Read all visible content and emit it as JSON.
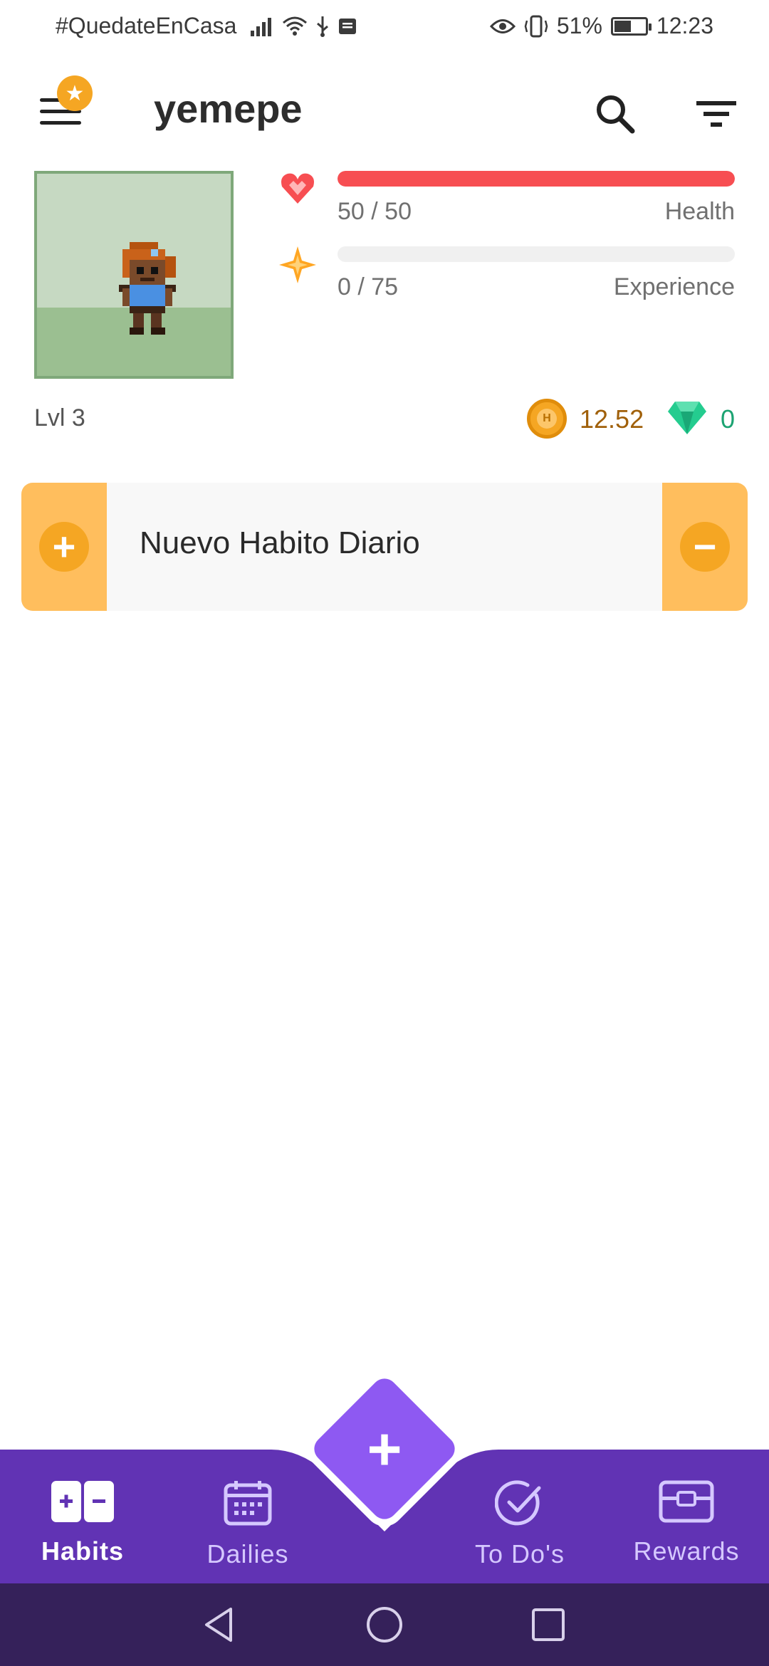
{
  "status_bar": {
    "carrier_text": "#QuedateEnCasa",
    "battery": "51%",
    "time": "12:23",
    "icons": [
      "signal-icon",
      "wifi-icon",
      "usb-icon",
      "notification-icon",
      "eye-icon",
      "vibrate-icon",
      "battery-icon"
    ]
  },
  "header": {
    "title": "yemepe",
    "icons": [
      "menu-icon",
      "star-badge-icon",
      "search-icon",
      "filter-icon"
    ]
  },
  "stats": {
    "health": {
      "value": "50 / 50",
      "label": "Health",
      "fraction": 1.0,
      "color": "#f74e52"
    },
    "experience": {
      "value": "0 / 75",
      "label": "Experience",
      "fraction": 0.0,
      "color": "#ffa623"
    },
    "level": "Lvl 3",
    "gold": "12.52",
    "gems": "0"
  },
  "habits": [
    {
      "title": "Nuevo Habito Diario",
      "plus_icon": "plus-icon",
      "minus_icon": "minus-icon"
    }
  ],
  "bottom_nav": {
    "items": [
      {
        "label": "Habits",
        "icon": "habits-icon",
        "active": true
      },
      {
        "label": "Dailies",
        "icon": "calendar-icon",
        "active": false
      },
      {
        "label": "To Do's",
        "icon": "check-circle-icon",
        "active": false
      },
      {
        "label": "Rewards",
        "icon": "chest-icon",
        "active": false
      }
    ],
    "fab_icon": "plus-icon",
    "bar_color": "#6133b4",
    "fab_color": "#8e59f2"
  },
  "system_nav": [
    "back-icon",
    "home-icon",
    "recents-icon"
  ]
}
